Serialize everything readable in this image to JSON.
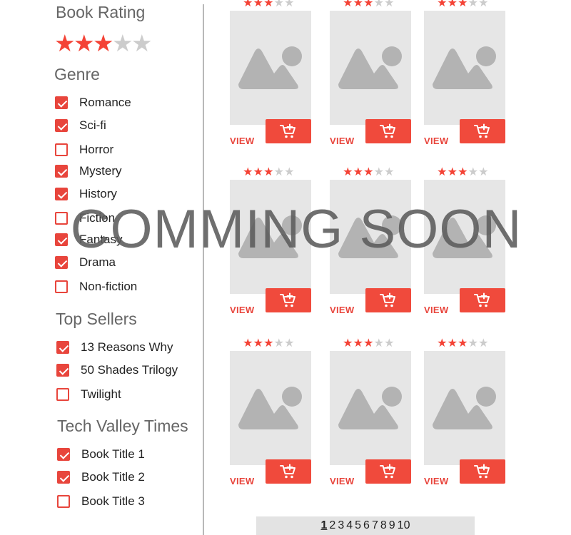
{
  "colors": {
    "accent": "#e8453c",
    "star_on": "#f44336",
    "star_off": "#cccccc",
    "placeholder_bg": "#e6e6e6",
    "placeholder_fg": "#b3b3b3"
  },
  "sidebar": {
    "rating": {
      "title": "Book Rating",
      "value": 3,
      "max": 5
    },
    "genre": {
      "title": "Genre",
      "items": [
        {
          "label": "Romance",
          "checked": true
        },
        {
          "label": "Sci-fi",
          "checked": true
        },
        {
          "label": "Horror",
          "checked": false
        },
        {
          "label": "Mystery",
          "checked": true
        },
        {
          "label": "History",
          "checked": true
        },
        {
          "label": "Fiction",
          "checked": false
        },
        {
          "label": "Fantasy",
          "checked": true
        },
        {
          "label": "Drama",
          "checked": true
        },
        {
          "label": "Non-fiction",
          "checked": false
        }
      ]
    },
    "top_sellers": {
      "title": "Top Sellers",
      "items": [
        {
          "label": "13 Reasons Why",
          "checked": true
        },
        {
          "label": "50 Shades Trilogy",
          "checked": true
        },
        {
          "label": "Twilight",
          "checked": false
        }
      ]
    },
    "tech_valley_times": {
      "title": "Tech Valley Times",
      "items": [
        {
          "label": "Book Title 1",
          "checked": true
        },
        {
          "label": "Book Title 2",
          "checked": true
        },
        {
          "label": "Book Title 3",
          "checked": false
        }
      ]
    }
  },
  "products": [
    {
      "rating": 3,
      "max": 5,
      "view_label": "VIEW",
      "cart_icon": "add-to-cart-icon",
      "image_icon": "image-placeholder-icon"
    },
    {
      "rating": 3,
      "max": 5,
      "view_label": "VIEW",
      "cart_icon": "add-to-cart-icon",
      "image_icon": "image-placeholder-icon"
    },
    {
      "rating": 3,
      "max": 5,
      "view_label": "VIEW",
      "cart_icon": "add-to-cart-icon",
      "image_icon": "image-placeholder-icon"
    },
    {
      "rating": 3,
      "max": 5,
      "view_label": "VIEW",
      "cart_icon": "add-to-cart-icon",
      "image_icon": "image-placeholder-icon"
    },
    {
      "rating": 3,
      "max": 5,
      "view_label": "VIEW",
      "cart_icon": "add-to-cart-icon",
      "image_icon": "image-placeholder-icon"
    },
    {
      "rating": 3,
      "max": 5,
      "view_label": "VIEW",
      "cart_icon": "add-to-cart-icon",
      "image_icon": "image-placeholder-icon"
    },
    {
      "rating": 3,
      "max": 5,
      "view_label": "VIEW",
      "cart_icon": "add-to-cart-icon",
      "image_icon": "image-placeholder-icon"
    },
    {
      "rating": 3,
      "max": 5,
      "view_label": "VIEW",
      "cart_icon": "add-to-cart-icon",
      "image_icon": "image-placeholder-icon"
    },
    {
      "rating": 3,
      "max": 5,
      "view_label": "VIEW",
      "cart_icon": "add-to-cart-icon",
      "image_icon": "image-placeholder-icon"
    }
  ],
  "pagination": {
    "pages": [
      "1",
      "2",
      "3",
      "4",
      "5",
      "6",
      "7",
      "8",
      "9",
      "10"
    ],
    "current": "1"
  },
  "overlay": {
    "text": "COMMING SOON"
  }
}
